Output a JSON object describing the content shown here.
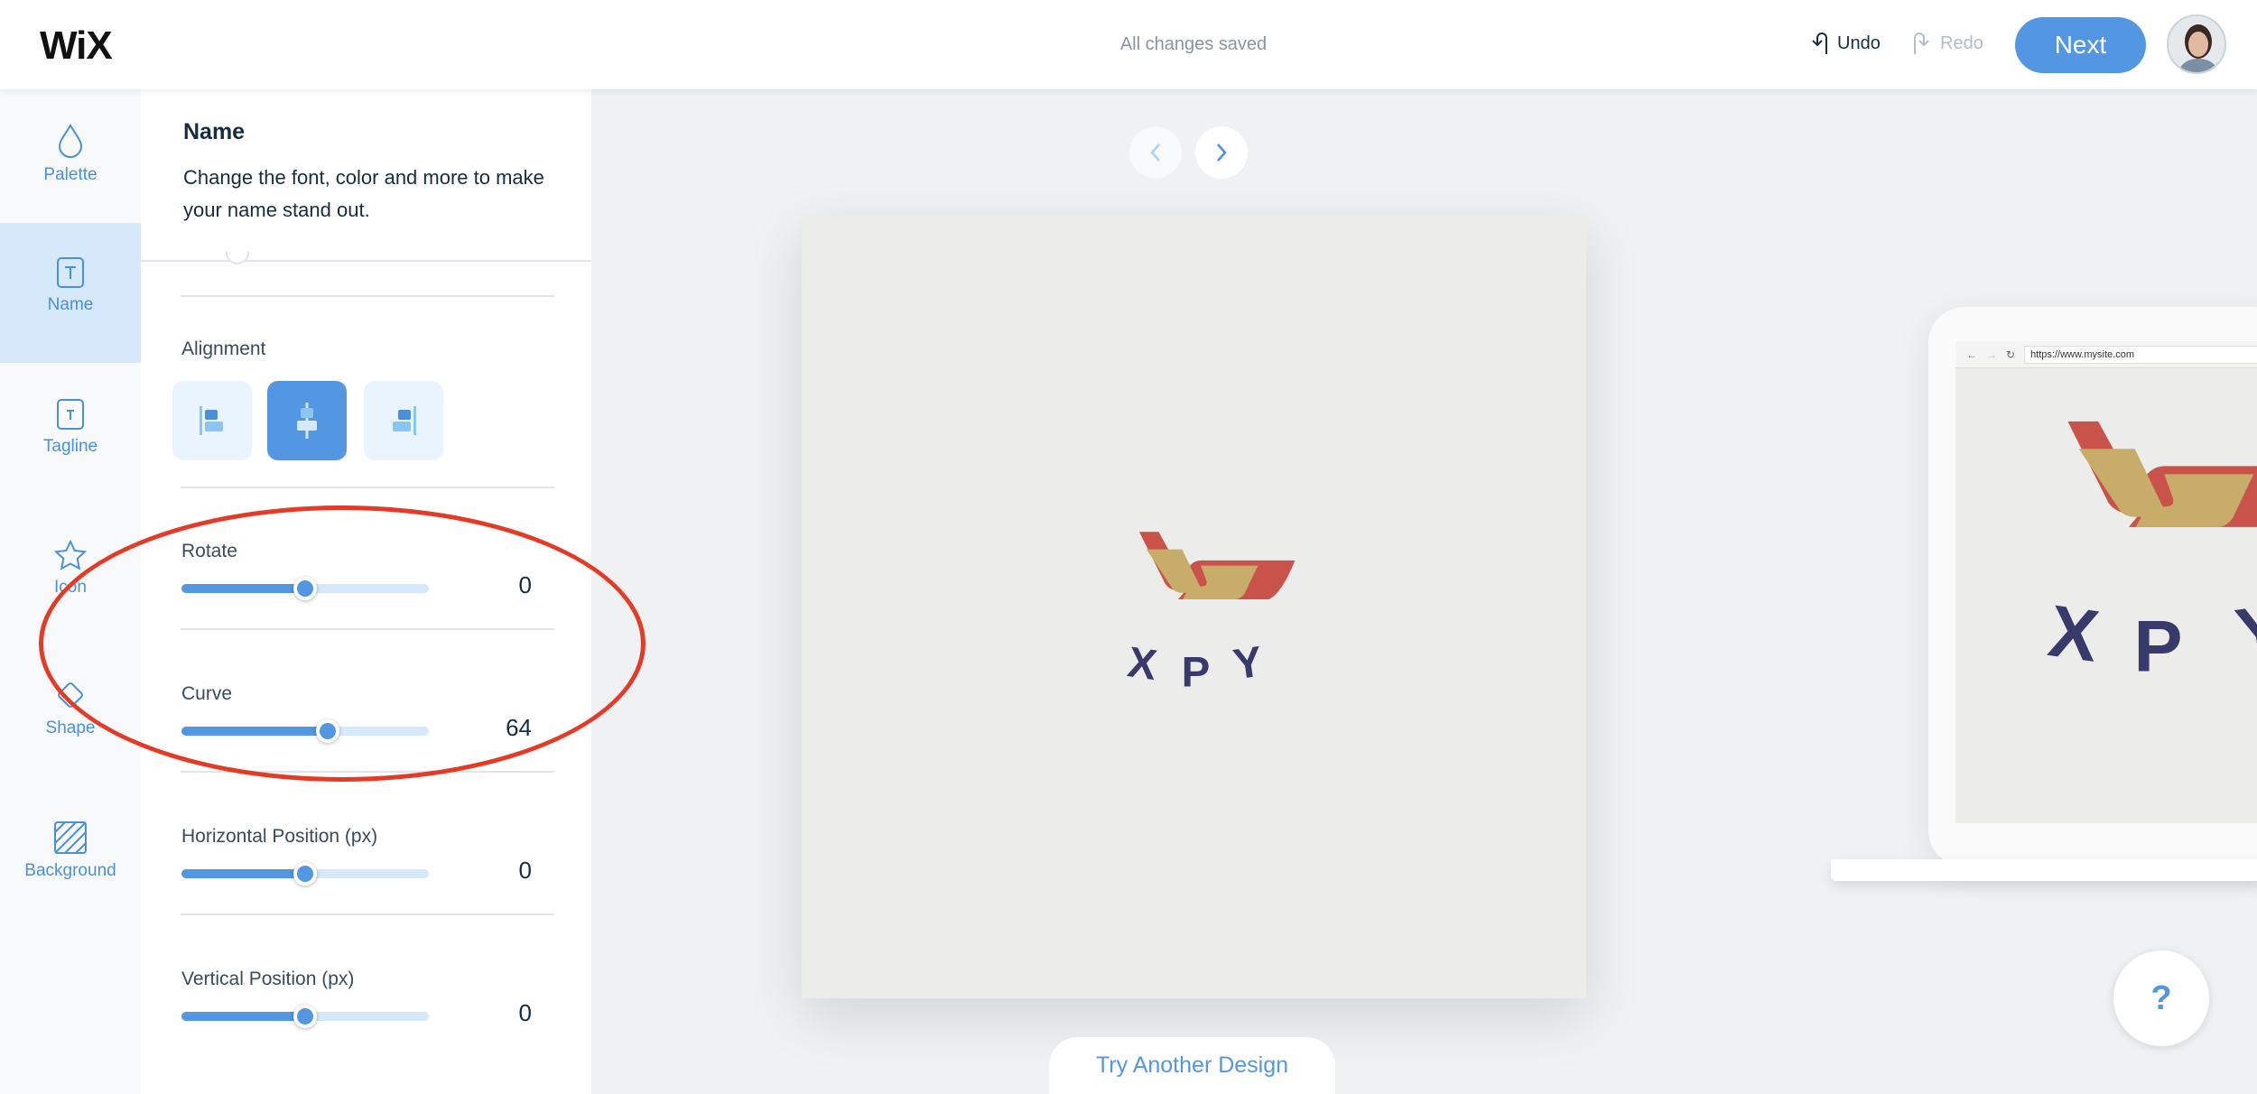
{
  "header": {
    "logo": "WiX",
    "status": "All changes saved",
    "undo": "Undo",
    "redo": "Redo",
    "next": "Next"
  },
  "rail": {
    "items": [
      {
        "label": "Palette",
        "icon": "drop-icon"
      },
      {
        "label": "Name",
        "icon": "text-box-icon",
        "active": true
      },
      {
        "label": "Tagline",
        "icon": "text-box-icon"
      },
      {
        "label": "Icon",
        "icon": "star-icon"
      },
      {
        "label": "Shape",
        "icon": "diamond-icon"
      },
      {
        "label": "Background",
        "icon": "hatch-icon"
      }
    ]
  },
  "panel": {
    "title": "Name",
    "description": "Change the font, color and more to make your name stand out.",
    "alignment": {
      "label": "Alignment",
      "options": [
        "left",
        "center",
        "right"
      ],
      "selected": "center"
    },
    "sliders": [
      {
        "label": "Rotate",
        "value": "0",
        "fraction": 0.5
      },
      {
        "label": "Curve",
        "value": "64",
        "fraction": 0.59
      },
      {
        "label": "Horizontal Position (px)",
        "value": "0",
        "fraction": 0.5
      },
      {
        "label": "Vertical Position (px)",
        "value": "0",
        "fraction": 0.5
      }
    ]
  },
  "preview": {
    "logo_text": "XPY",
    "url": "https://www.mysite.com",
    "try_another": "Try Another Design",
    "help": "?"
  },
  "colors": {
    "accent": "#5397e3",
    "logo_red": "#c9524b",
    "logo_gold": "#c8ad6a",
    "logo_text": "#373a6a",
    "annotation": "#e53a26"
  }
}
